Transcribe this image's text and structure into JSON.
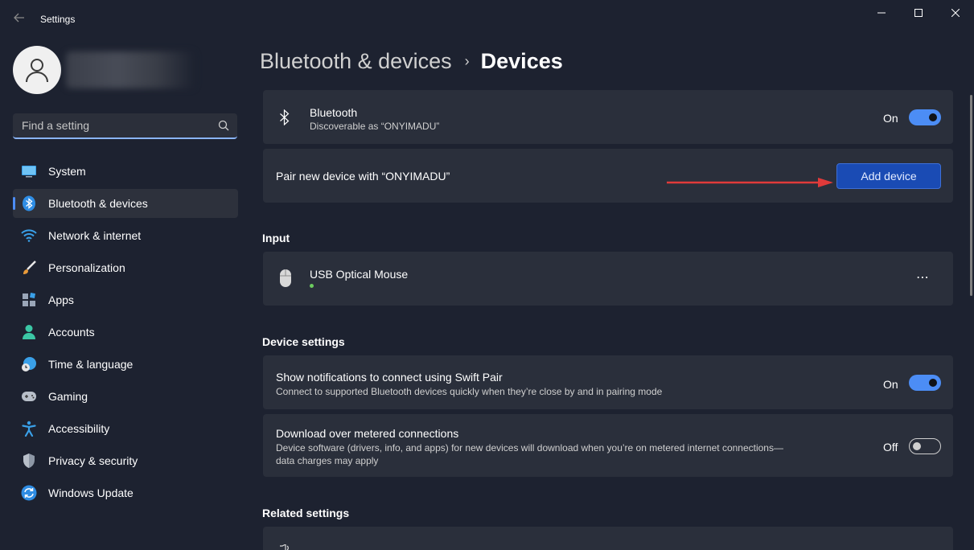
{
  "window": {
    "title": "Settings"
  },
  "sidebar": {
    "search_placeholder": "Find a setting",
    "items": [
      {
        "label": "System",
        "icon": "monitor-icon"
      },
      {
        "label": "Bluetooth & devices",
        "icon": "bluetooth-icon",
        "active": true
      },
      {
        "label": "Network & internet",
        "icon": "wifi-icon"
      },
      {
        "label": "Personalization",
        "icon": "brush-icon"
      },
      {
        "label": "Apps",
        "icon": "apps-icon"
      },
      {
        "label": "Accounts",
        "icon": "person-icon"
      },
      {
        "label": "Time & language",
        "icon": "globe-clock-icon"
      },
      {
        "label": "Gaming",
        "icon": "gamepad-icon"
      },
      {
        "label": "Accessibility",
        "icon": "accessibility-icon"
      },
      {
        "label": "Privacy & security",
        "icon": "shield-icon"
      },
      {
        "label": "Windows Update",
        "icon": "update-icon"
      }
    ]
  },
  "breadcrumb": {
    "parent": "Bluetooth & devices",
    "separator": "›",
    "current": "Devices"
  },
  "bluetooth": {
    "title": "Bluetooth",
    "subtitle": "Discoverable as “ONYIMADU”",
    "state_label": "On"
  },
  "pair": {
    "label": "Pair new device with “ONYIMADU”",
    "button": "Add device"
  },
  "input_section": {
    "title": "Input",
    "devices": [
      {
        "name": "USB Optical Mouse",
        "status": "connected"
      }
    ],
    "more_label": "⋯"
  },
  "device_settings": {
    "title": "Device settings",
    "swift_pair": {
      "title": "Show notifications to connect using Swift Pair",
      "subtitle": "Connect to supported Bluetooth devices quickly when they’re close by and in pairing mode",
      "state_label": "On"
    },
    "metered": {
      "title": "Download over metered connections",
      "subtitle_line1": "Device software (drivers, info, and apps) for new devices will download when you’re on metered internet connections—",
      "subtitle_line2": "data charges may apply",
      "state_label": "Off"
    }
  },
  "related_settings": {
    "title": "Related settings"
  },
  "colors": {
    "accent": "#4c8df5",
    "button": "#1a4bb4",
    "background": "#1d2230",
    "card": "#2a2f3b",
    "connected_dot": "#6ccb5f"
  }
}
